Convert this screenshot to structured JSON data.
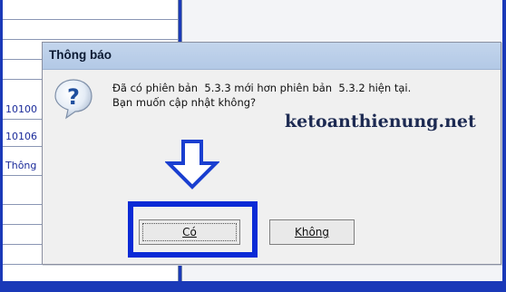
{
  "background": {
    "rows": [
      "",
      "",
      "",
      "",
      "10100",
      "10106",
      "Thông",
      "",
      "",
      "",
      "",
      "",
      "",
      ""
    ]
  },
  "dialog": {
    "title": "Thông báo",
    "message_line1": "Đã có phiên bản  5.3.3 mới hơn phiên bản  5.3.2 hiện tại.",
    "message_line2": "Bạn muốn cập nhật không?",
    "yes_label": "Có",
    "no_label": "Không",
    "icon": "question-icon"
  },
  "watermark": "ketoanthienung.net",
  "colors": {
    "highlight": "#0a2ad6",
    "frame": "#1a39b8",
    "title_bar": "#b8cde8"
  }
}
